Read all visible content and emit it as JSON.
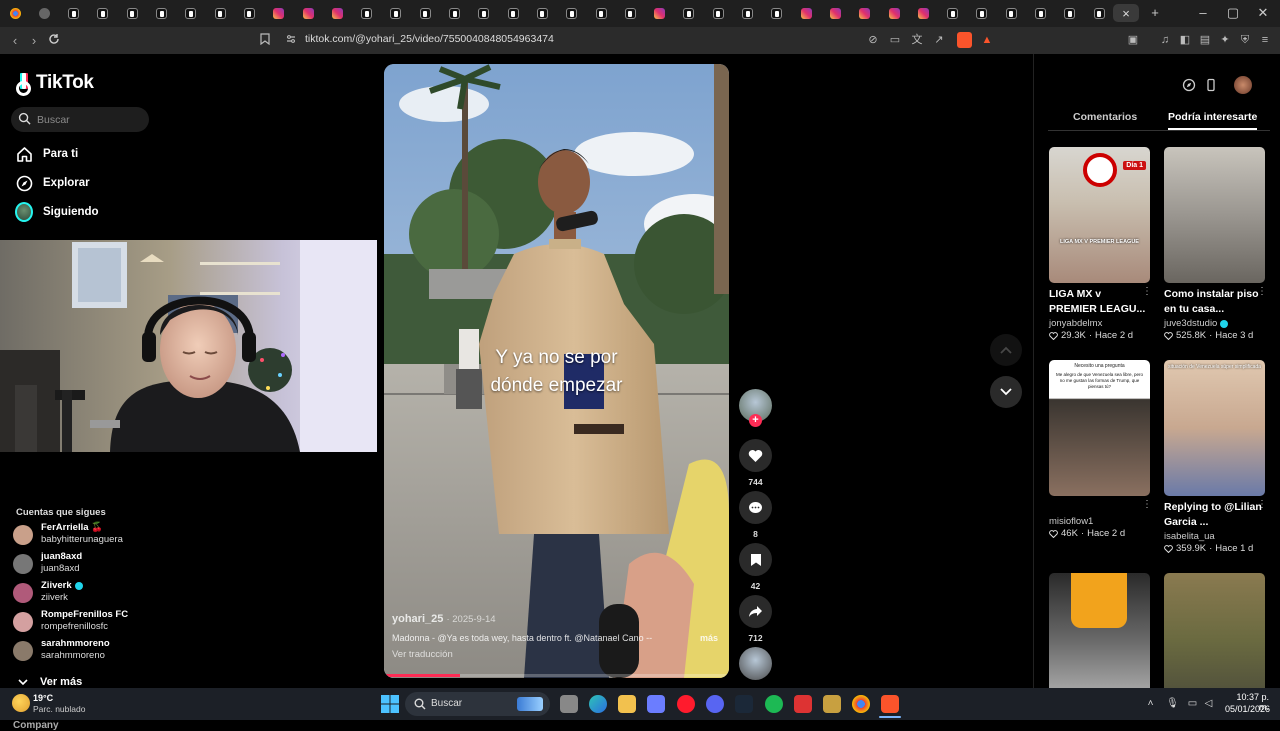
{
  "browser": {
    "tab_favicons": [
      "chrome",
      "spaces",
      "tiktok",
      "tiktok",
      "tiktok",
      "tiktok",
      "tiktok",
      "tiktok",
      "tiktok",
      "instagram",
      "instagram",
      "instagram",
      "tiktok",
      "tiktok",
      "tiktok",
      "tiktok",
      "tiktok",
      "tiktok",
      "tiktok",
      "tiktok",
      "tiktok",
      "tiktok",
      "instagram",
      "tiktok",
      "tiktok",
      "tiktok",
      "tiktok",
      "instagram",
      "instagram",
      "instagram",
      "instagram",
      "instagram",
      "tiktok",
      "tiktok",
      "tiktok",
      "tiktok",
      "tiktok",
      "tiktok"
    ],
    "url": "tiktok.com/@yohari_25/video/7550040848054963474",
    "new_tab": "+",
    "close_tab": "×"
  },
  "tiktok": {
    "logo_text": "TikTok",
    "search_placeholder": "Buscar",
    "nav": [
      {
        "label": "Para ti",
        "icon": "home-icon"
      },
      {
        "label": "Explorar",
        "icon": "compass-icon"
      },
      {
        "label": "Siguiendo",
        "icon": "following-avatar"
      }
    ],
    "following_title": "Cuentas que sigues",
    "following": [
      {
        "name": "FerArriella 🍒",
        "handle": "babyhitterunaguera",
        "color": "#c9a08a"
      },
      {
        "name": "juan8axd",
        "handle": "juan8axd",
        "color": "#777777"
      },
      {
        "name": "Ziiverk",
        "handle": "ziiverk",
        "color": "#b05a7a",
        "verified": true
      },
      {
        "name": "RompeFrenillos FC",
        "handle": "rompefrenillosfc",
        "color": "#d4a0a0"
      },
      {
        "name": "sarahmmoreno",
        "handle": "sarahmmoreno",
        "color": "#8a7a6a"
      }
    ],
    "see_more": "Ver más",
    "company": "Company"
  },
  "video": {
    "caption_line1": "Y ya no se por",
    "caption_line2": "dónde empezar",
    "author": "yohari_25",
    "date": "2025-9-14",
    "description": "Madonna - @Ya es toda wey, hasta dentro ft. @Natanael Cano --",
    "more": "más",
    "translate": "Ver traducción",
    "progress": 0.22
  },
  "actions": {
    "likes": "744",
    "comments": "8",
    "saves": "42",
    "shares": "712"
  },
  "right_panel": {
    "tab_comments": "Comentarios",
    "tab_interesting": "Podría interesarte",
    "cards": [
      {
        "title": "LIGA MX v PREMIER LEAGU...",
        "author": "jonyabdelmx",
        "likes": "29.3K",
        "age": "Hace 2 d",
        "verified": false,
        "thumb_text": "LIGA MX V PREMIER LEAGUE",
        "badge": "Día 1"
      },
      {
        "title": "Como instalar piso en tu casa...",
        "author": "juve3dstudio",
        "likes": "525.8K",
        "age": "Hace 3 d",
        "verified": true,
        "thumb_text": "",
        "badge": ""
      },
      {
        "title": "",
        "author": "misioflow1",
        "likes": "46K",
        "age": "Hace 2 d",
        "verified": false,
        "thumb_text": "Me alegro de que Venezuela sea libre, pero no me gustan las formas de Trump, que piensas tú?",
        "badge": "Necesito una pregunta"
      },
      {
        "title": "Replying to @Lilian Garcia ...",
        "author": "isabelita_ua",
        "likes": "359.9K",
        "age": "Hace 1 d",
        "verified": false,
        "thumb_text": "situación de Venezuela súper simplificada",
        "badge": ""
      },
      {
        "title": "",
        "author": "",
        "likes": "",
        "age": "",
        "verified": false,
        "thumb_text": "",
        "badge": ""
      },
      {
        "title": "",
        "author": "",
        "likes": "",
        "age": "",
        "verified": false,
        "thumb_text": "",
        "badge": ""
      }
    ]
  },
  "taskbar": {
    "weather_temp": "19°C",
    "weather_desc": "Parc. nublado",
    "search_label": "Buscar",
    "time": "10:37 p. m.",
    "date": "05/01/2026"
  }
}
